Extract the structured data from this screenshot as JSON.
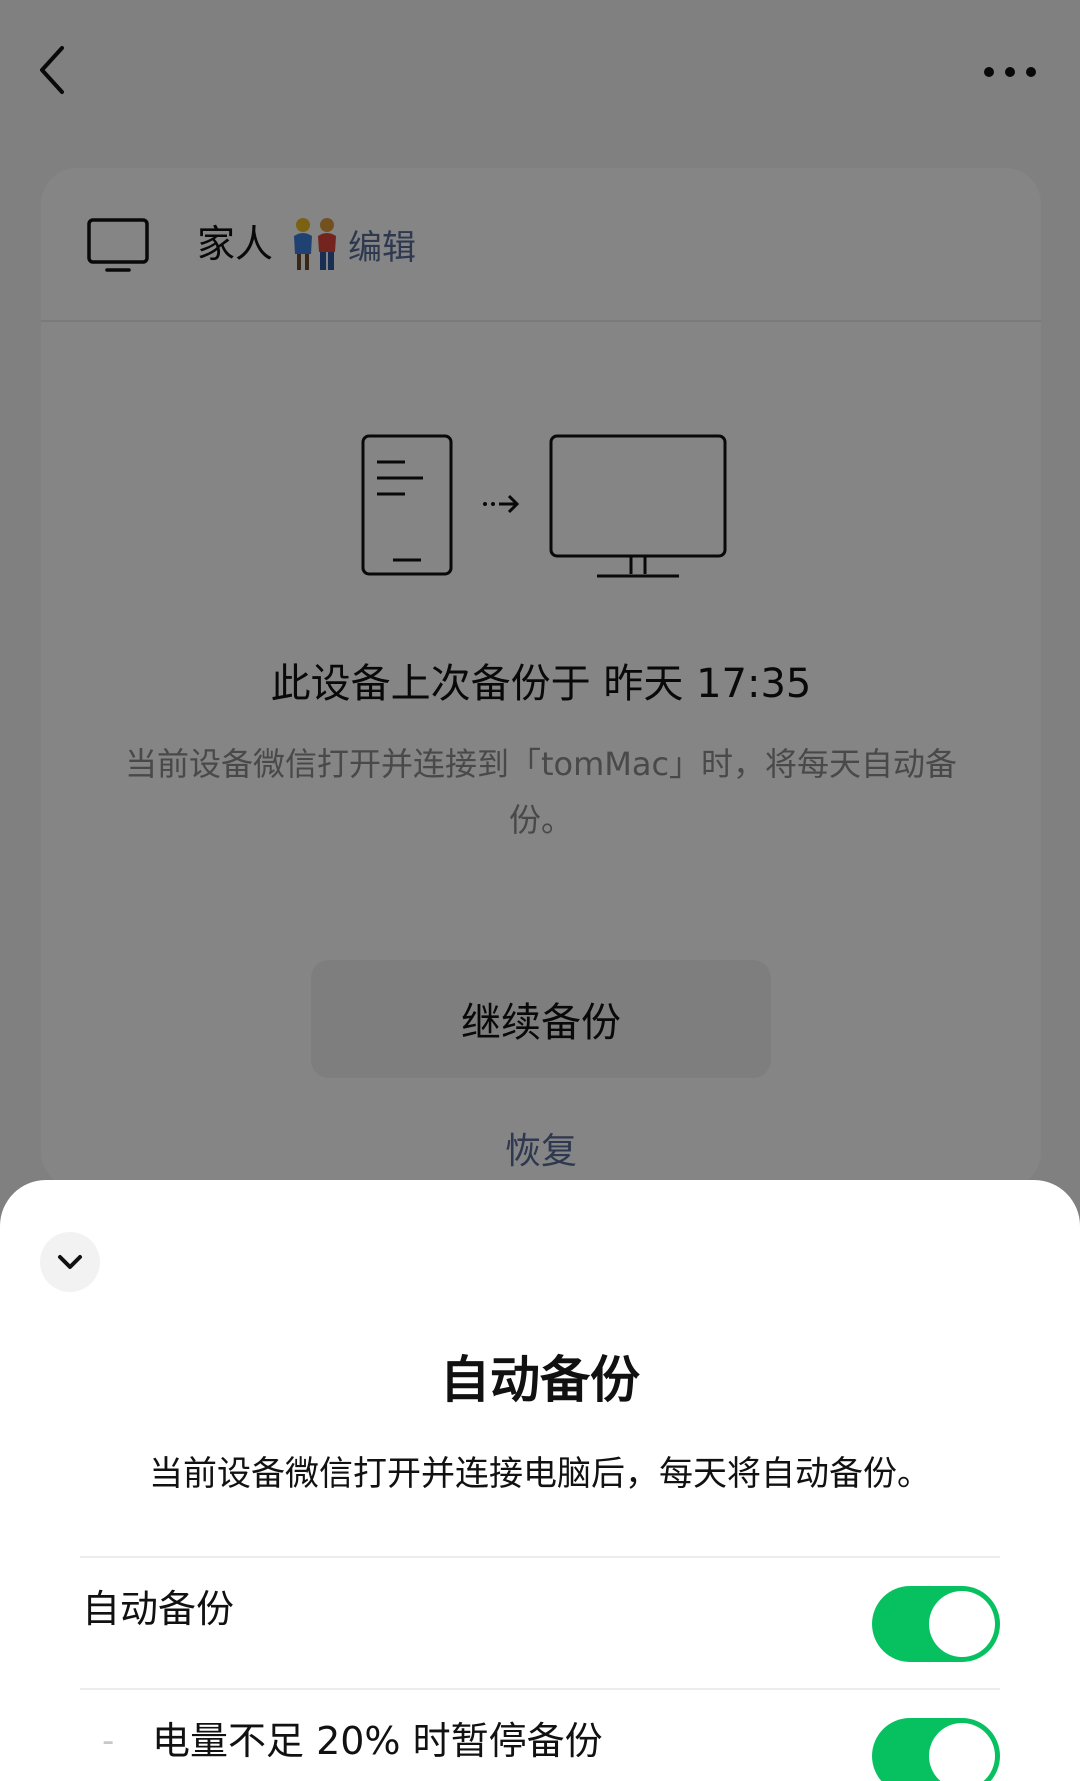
{
  "background_screen": {
    "device": {
      "name": "家人",
      "edit_label": "编辑"
    },
    "last_backup_text": "此设备上次备份于 昨天 17:35",
    "description": "当前设备微信打开并连接到「tomMac」时，将每天自动备份。",
    "continue_button_label": "继续备份",
    "restore_label": "恢复"
  },
  "bottom_sheet": {
    "title": "自动备份",
    "description": "当前设备微信打开并连接电脑后，每天将自动备份。",
    "settings": [
      {
        "label": "自动备份",
        "enabled": true
      },
      {
        "label": "电量不足 20% 时暂停备份",
        "enabled": true,
        "sub_marker": "-"
      }
    ]
  },
  "colors": {
    "toggle_on": "#07c160",
    "link": "#576b95"
  }
}
